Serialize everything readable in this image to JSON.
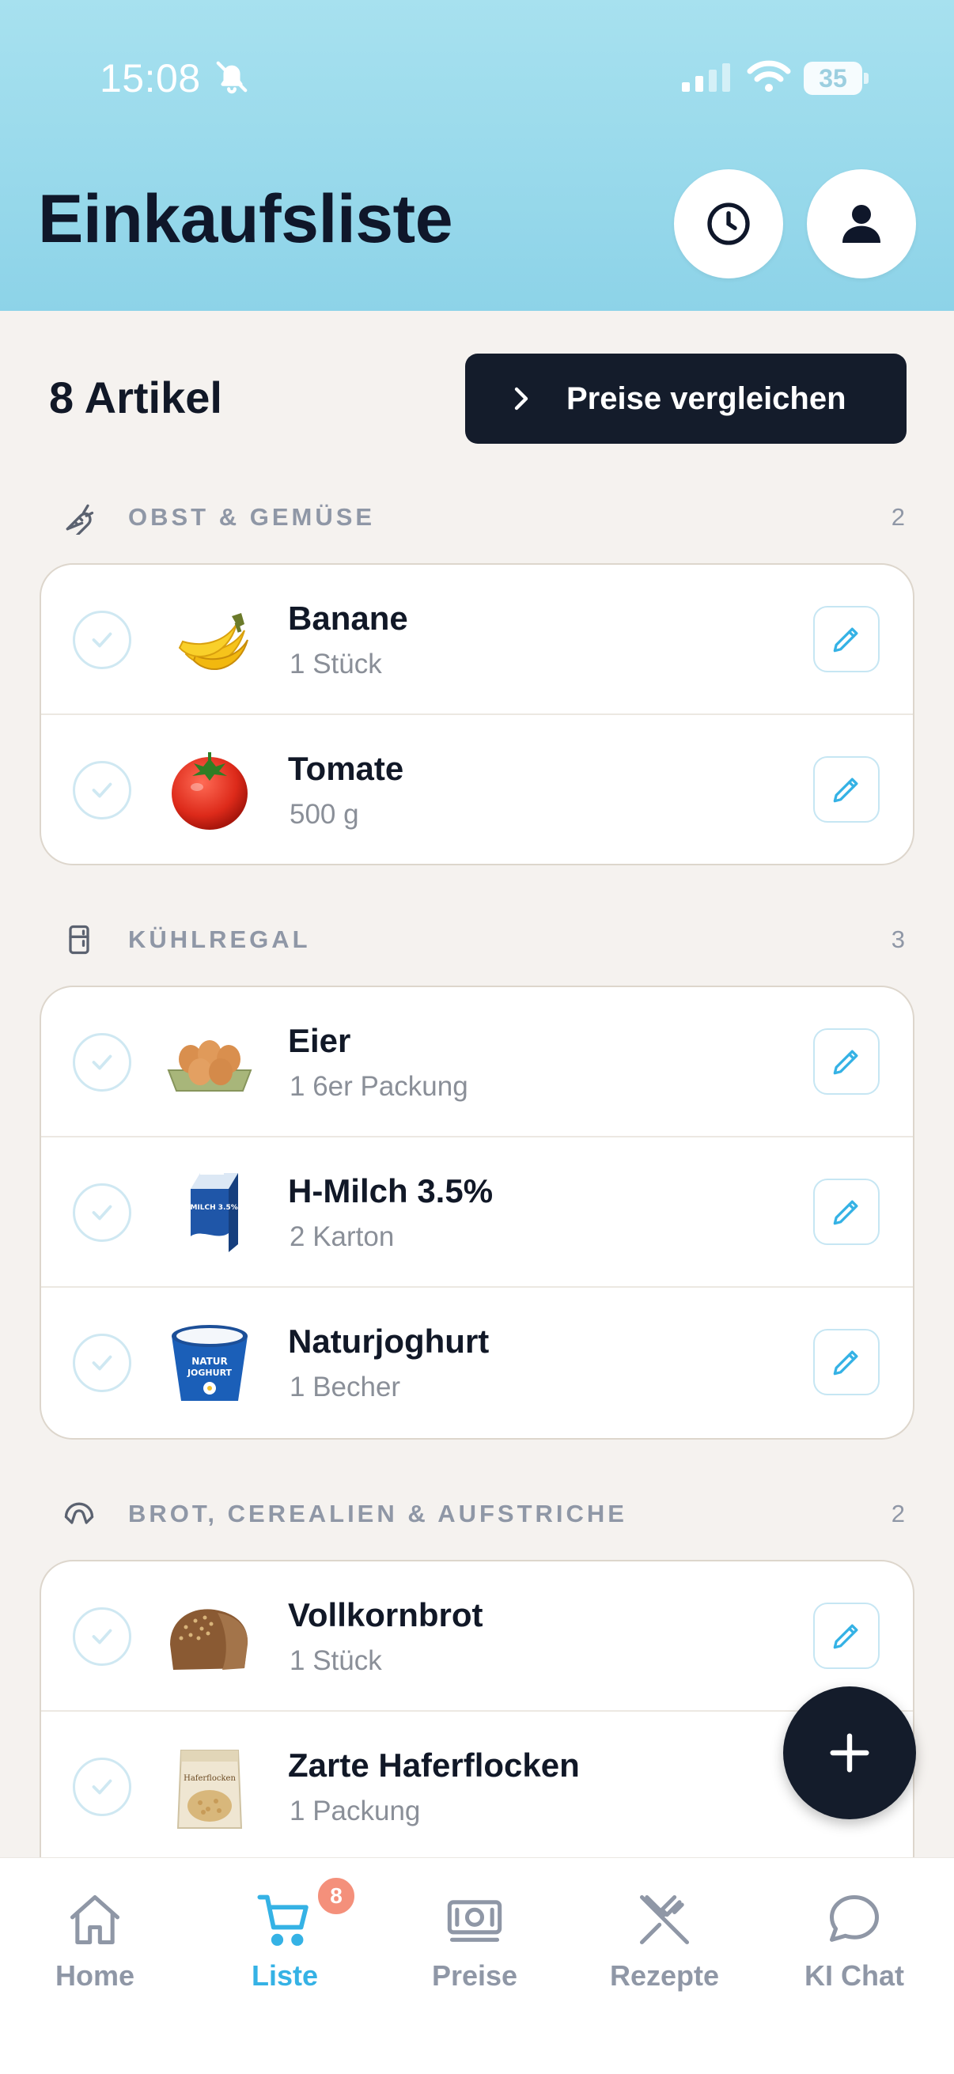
{
  "status_bar": {
    "time": "15:08",
    "battery": "35"
  },
  "header": {
    "title": "Einkaufsliste",
    "history_icon": "clock-icon",
    "profile_icon": "user-icon",
    "background": "#9fdcec"
  },
  "summary": {
    "count_label": "8 Artikel",
    "compare_label": "Preise vergleichen"
  },
  "sections": [
    {
      "title": "OBST & GEMÜSE",
      "count": "2",
      "icon": "carrot-icon",
      "items": [
        {
          "name": "Banane",
          "qty": "1 Stück",
          "image": "banana"
        },
        {
          "name": "Tomate",
          "qty": "500 g",
          "image": "tomato"
        }
      ]
    },
    {
      "title": "KÜHLREGAL",
      "count": "3",
      "icon": "fridge-icon",
      "items": [
        {
          "name": "Eier",
          "qty": "1 6er Packung",
          "image": "eggs"
        },
        {
          "name": "H-Milch 3.5%",
          "qty": "2 Karton",
          "image": "milk"
        },
        {
          "name": "Naturjoghurt",
          "qty": "1 Becher",
          "image": "yogurt"
        }
      ]
    },
    {
      "title": "BROT, CEREALIEN & AUFSTRICHE",
      "count": "2",
      "icon": "croissant-icon",
      "items": [
        {
          "name": "Vollkornbrot",
          "qty": "1 Stück",
          "image": "bread"
        },
        {
          "name": "Zarte Haferflocken",
          "qty": "1 Packung",
          "image": "oats"
        }
      ]
    }
  ],
  "package_labels": {
    "milk": "H-MILCH 3.5%",
    "yogurt_line1": "NATUR",
    "yogurt_line2": "JOGHURT",
    "oats": "Haferflocken"
  },
  "nav": {
    "items": [
      {
        "label": "Home",
        "icon": "home-icon"
      },
      {
        "label": "Liste",
        "icon": "cart-icon"
      },
      {
        "label": "Preise",
        "icon": "banknote-icon"
      },
      {
        "label": "Rezepte",
        "icon": "utensils-icon"
      },
      {
        "label": "KI Chat",
        "icon": "chat-icon"
      }
    ],
    "active": "Liste",
    "badge": "8"
  },
  "colors": {
    "accent": "#35b2e5",
    "dark": "#141c2b",
    "badge": "#f4907b",
    "muted": "#8f97a6"
  }
}
